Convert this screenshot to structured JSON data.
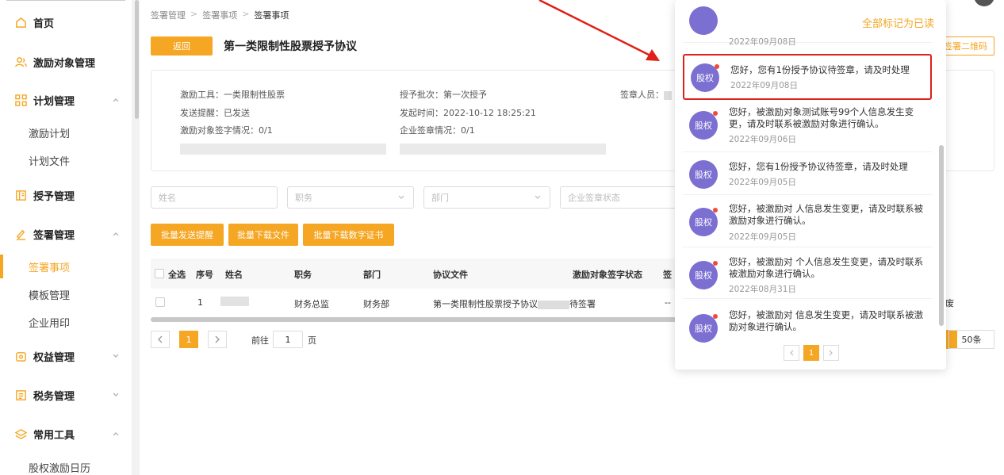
{
  "sidebar": {
    "items": [
      {
        "label": "首页",
        "icon": "home-icon"
      },
      {
        "label": "激励对象管理",
        "icon": "users-icon"
      },
      {
        "label": "计划管理",
        "icon": "grid-icon",
        "expanded": true
      },
      {
        "label": "授予管理",
        "icon": "book-icon"
      },
      {
        "label": "签署管理",
        "icon": "sign-icon",
        "expanded": true
      },
      {
        "label": "权益管理",
        "icon": "equity-icon"
      },
      {
        "label": "税务管理",
        "icon": "tax-icon"
      },
      {
        "label": "常用工具",
        "icon": "layers-icon",
        "expanded": true
      }
    ],
    "sub_plan": [
      "激励计划",
      "计划文件"
    ],
    "sub_sign": [
      "签署事项",
      "模板管理",
      "企业用印"
    ],
    "sub_tools": [
      "股权激励日历"
    ]
  },
  "breadcrumb": [
    "签署管理",
    "签署事项",
    "签署事项"
  ],
  "header": {
    "back_label": "返回",
    "title": "第一类限制性股票授予协议",
    "qr_label": "签署二维码"
  },
  "info": {
    "tool": "激励工具：一类限制性股票",
    "reminder": "发送提醒：已发送",
    "object_sign": "激励对象签字情况：0/1",
    "batch": "授予批次：第一次授予",
    "start_time": "发起时间：2022-10-12 18:25:21",
    "company_sign": "企业签章情况：0/1",
    "signer": "签章人员："
  },
  "filters": {
    "name": "姓名",
    "position": "职务",
    "department": "部门",
    "company_status": "企业签章状态"
  },
  "actions": [
    "批量发送提醒",
    "批量下载文件",
    "批量下载数字证书"
  ],
  "table": {
    "select_all": "全选",
    "headers": [
      "序号",
      "姓名",
      "职务",
      "部门",
      "协议文件",
      "激励对象签字状态",
      "签"
    ],
    "rows": [
      {
        "index": "1",
        "position": "财务总监",
        "department": "财务部",
        "file": "第一类限制性股票授予协议",
        "status": "待签署",
        "company": "--",
        "op": "作废"
      }
    ]
  },
  "pager": {
    "prefix": "前往",
    "page": "1",
    "suffix": "页",
    "current": "1",
    "page_size": "50条"
  },
  "notifications": {
    "mark_all": "全部标记为已读",
    "avatar_text": "股权",
    "items": [
      {
        "msg": "",
        "time": "2022年09月08日"
      },
      {
        "msg": "您好，您有1份授予协议待签章，请及时处理",
        "time": "2022年09月08日"
      },
      {
        "msg": "您好，被激励对象测试账号99个人信息发生变更，请及时联系被激励对象进行确认。",
        "time": "2022年09月06日"
      },
      {
        "msg": "您好，您有1份授予协议待签章，请及时处理",
        "time": "2022年09月05日"
      },
      {
        "msg": "您好，被激励对 人信息发生变更，请及时联系被激励对象进行确认。",
        "time": "2022年09月05日"
      },
      {
        "msg": "您好，被激励对 个人信息发生变更，请及时联系被激励对象进行确认。",
        "time": "2022年08月31日"
      },
      {
        "msg": "您好，被激励对 信息发生变更，请及时联系被激励对象进行确认。",
        "time": ""
      }
    ],
    "page": "1"
  },
  "colors": {
    "accent": "#f5a623",
    "avatar": "#7b6fd1",
    "highlight": "#e0201a"
  }
}
